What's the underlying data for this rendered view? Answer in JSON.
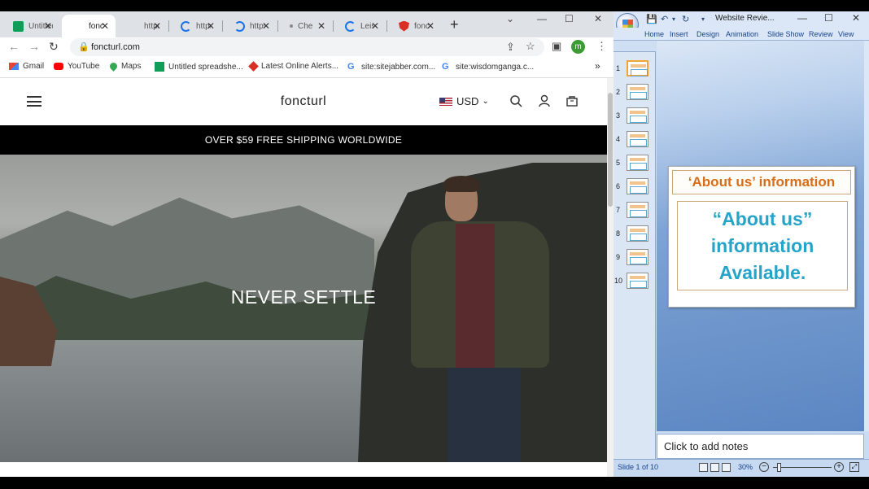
{
  "chrome": {
    "tabs": [
      {
        "label": "Untitled",
        "favicon": "sheets-icon",
        "color": "#0f9d58"
      },
      {
        "label": "foncturl",
        "favicon": "site-icon",
        "color": "#ffffff"
      },
      {
        "label": "https://",
        "favicon": "blank-icon",
        "color": "#dee1e6"
      },
      {
        "label": "https://",
        "favicon": "loading-icon",
        "color": "#1a73e8"
      },
      {
        "label": "https://",
        "favicon": "loading-icon",
        "color": "#1a73e8"
      },
      {
        "label": "Check",
        "favicon": "dot-icon",
        "color": "#888888"
      },
      {
        "label": "Leisure",
        "favicon": "loading-icon",
        "color": "#1a73e8"
      },
      {
        "label": "foncturl",
        "favicon": "shield-icon",
        "color": "#d93025"
      }
    ],
    "url": "foncturl.com",
    "avatar_letter": "m",
    "bookmarks": [
      {
        "label": "Gmail",
        "icon": "gmail-icon"
      },
      {
        "label": "YouTube",
        "icon": "youtube-icon"
      },
      {
        "label": "Maps",
        "icon": "maps-icon"
      },
      {
        "label": "Untitled spreadshe...",
        "icon": "sheets-icon"
      },
      {
        "label": "Latest Online Alerts...",
        "icon": "alert-icon"
      },
      {
        "label": "site:sitejabber.com...",
        "icon": "google-icon"
      },
      {
        "label": "site:wisdomganga.c...",
        "icon": "google-icon"
      }
    ],
    "more_bookmarks": "»"
  },
  "site": {
    "brand": "foncturl",
    "currency": "USD",
    "announcement": "OVER $59 FREE SHIPPING WORLDWIDE",
    "hero_headline": "NEVER SETTLE"
  },
  "ppt": {
    "doc_title": "Website Revie...",
    "ribbon_tabs": [
      "Home",
      "Insert",
      "Design",
      "Animation",
      "Slide Show",
      "Review",
      "View"
    ],
    "slide_numbers": [
      "1",
      "2",
      "3",
      "4",
      "5",
      "6",
      "7",
      "8",
      "9",
      "10"
    ],
    "slide_title": "‘About us’ information",
    "slide_body": "“About us” information Available.",
    "notes_placeholder": "Click to add notes",
    "status": "Slide 1 of 10",
    "zoom": "30%"
  }
}
